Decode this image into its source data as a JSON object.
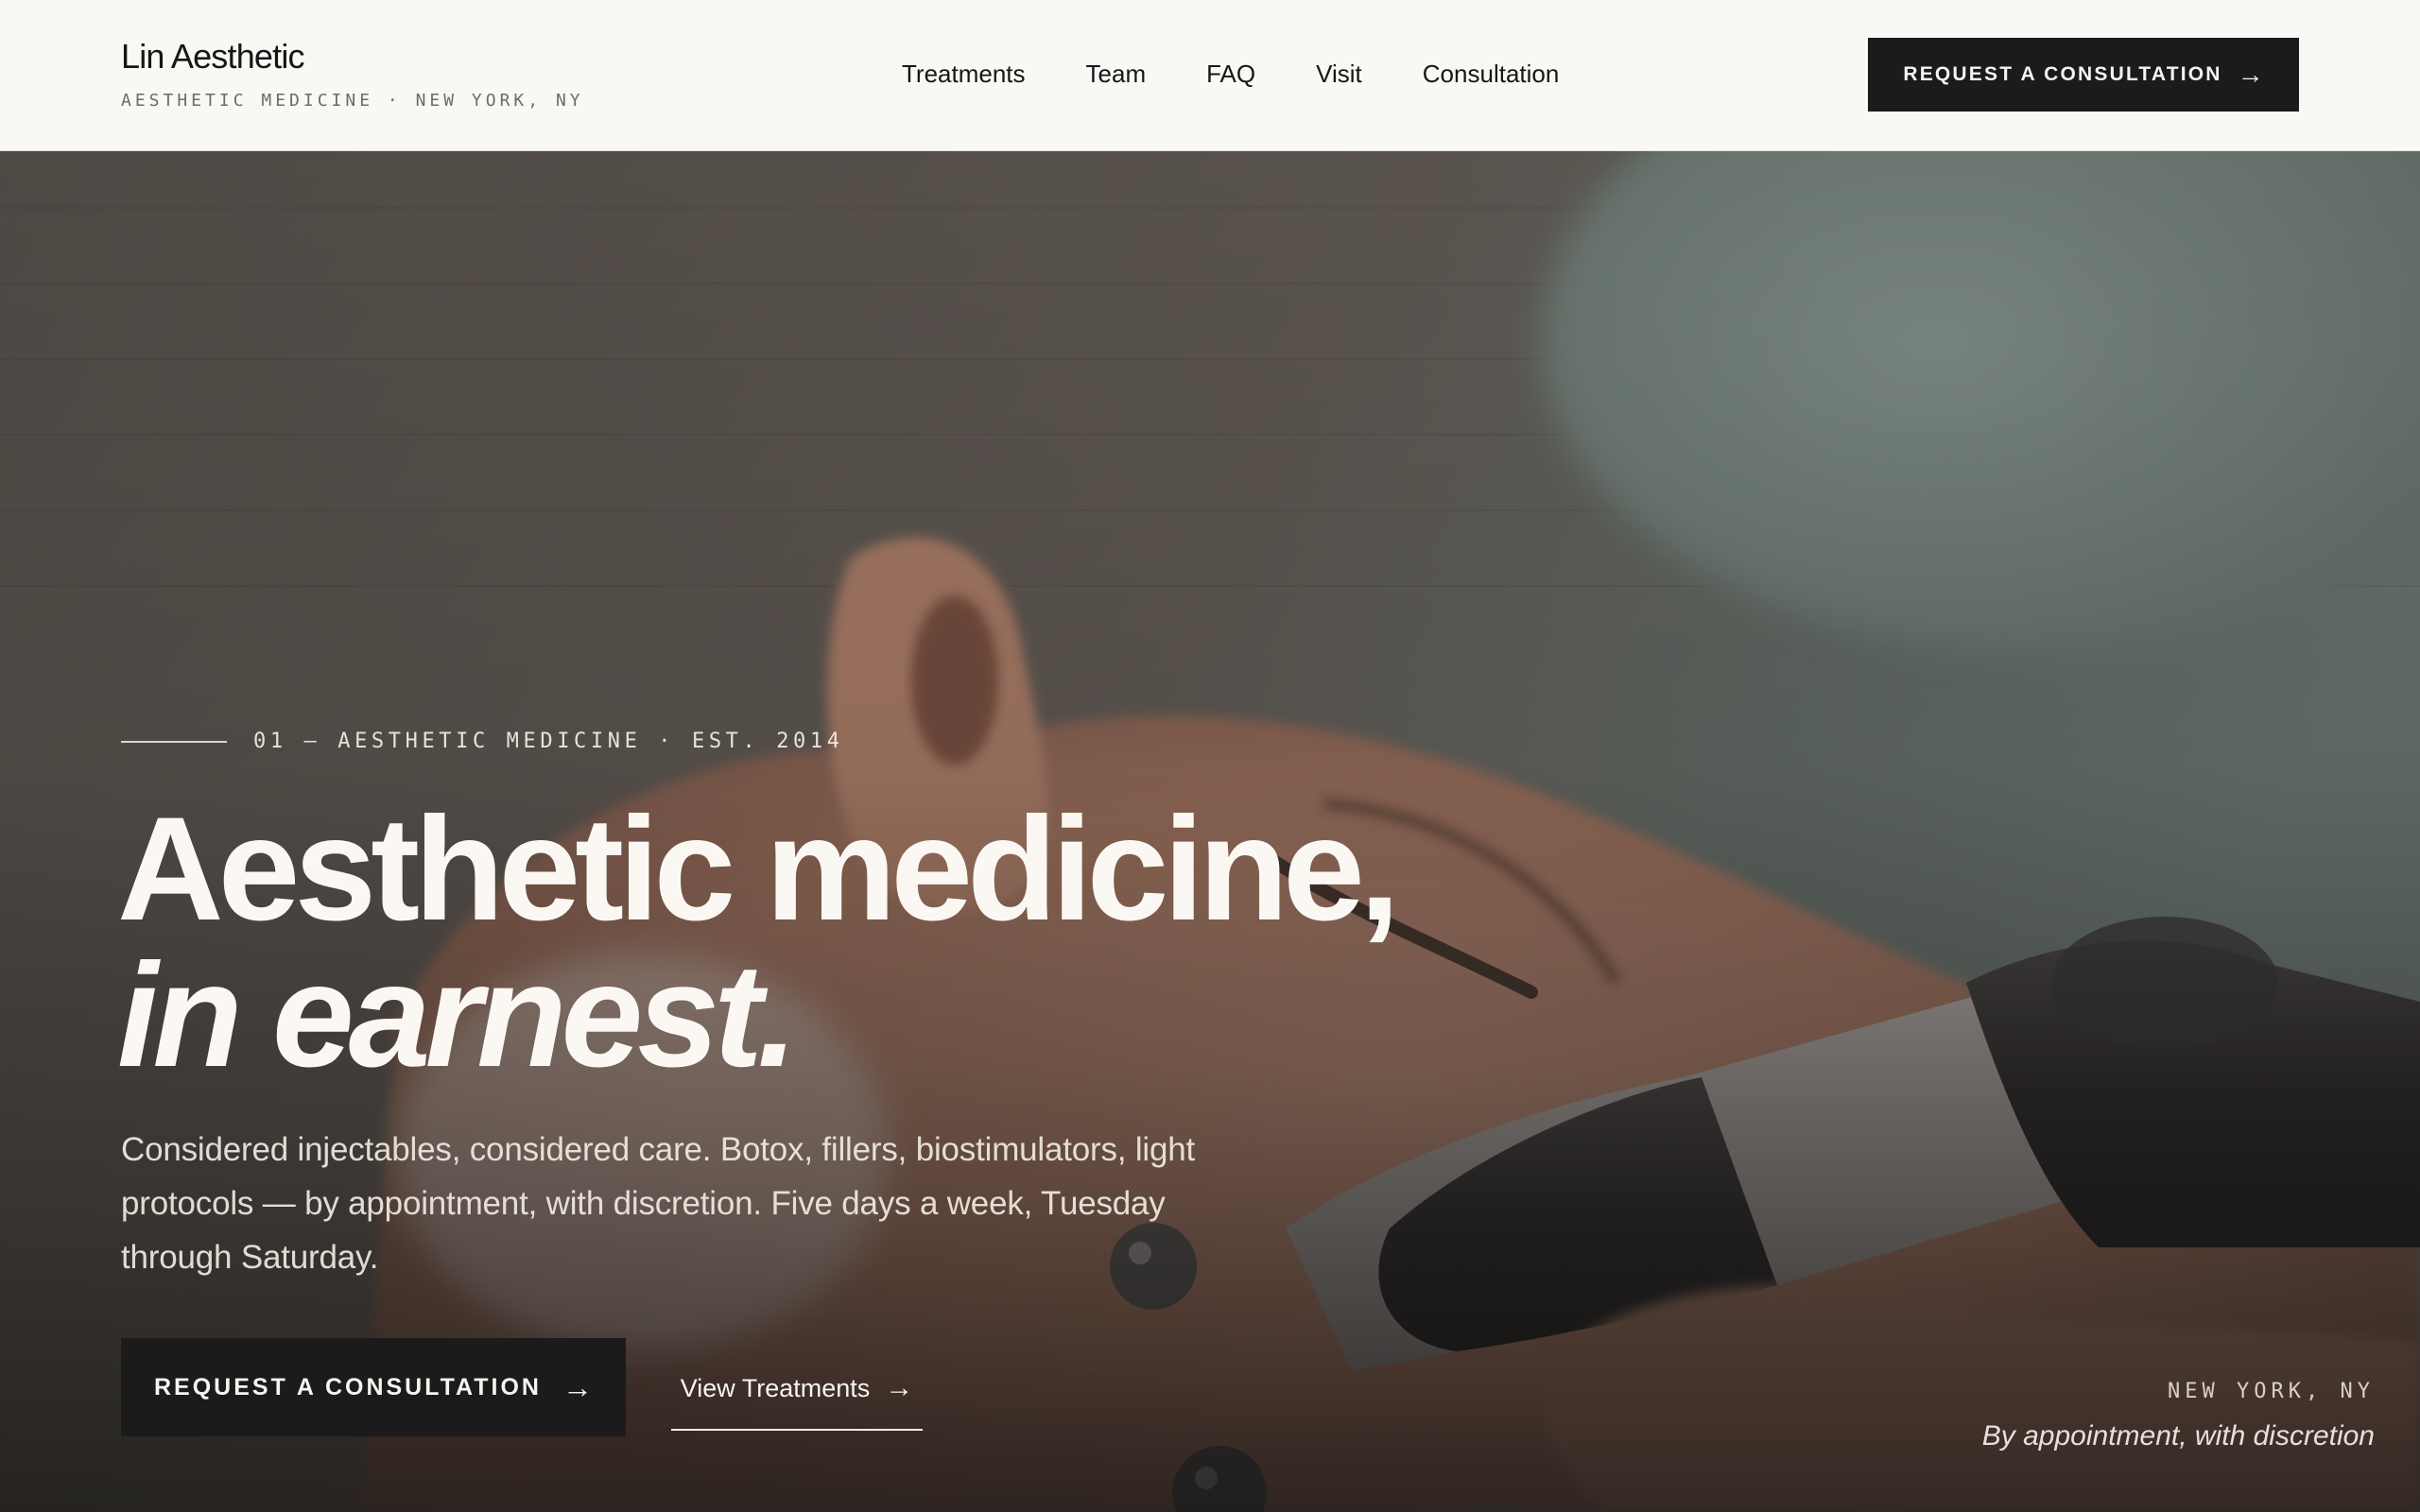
{
  "header": {
    "brand_name": "Lin Aesthetic",
    "brand_tagline": "AESTHETIC MEDICINE · NEW YORK, NY",
    "nav": [
      {
        "label": "Treatments"
      },
      {
        "label": "Team"
      },
      {
        "label": "FAQ"
      },
      {
        "label": "Visit"
      },
      {
        "label": "Consultation"
      }
    ],
    "cta_label": "REQUEST A CONSULTATION",
    "cta_icon": "arrow-right-icon"
  },
  "hero": {
    "eyebrow": "01 — AESTHETIC MEDICINE · EST. 2014",
    "headline_line1": "Aesthetic medicine,",
    "headline_line2": "in earnest.",
    "lede": "Considered injectables, considered care. Botox, fillers, biostimulators, light protocols — by appointment, with discretion. Five days a week, Tuesday through Saturday.",
    "primary_cta": "REQUEST A CONSULTATION",
    "secondary_cta": "View Treatments",
    "arrow": "→",
    "location": "NEW YORK, NY",
    "location_note": "By appointment, with discretion"
  },
  "colors": {
    "page_bg": "#f9f8f4",
    "button_bg": "#1b1b1b",
    "button_text": "#f6f4ef",
    "hero_text": "#fbf8f3"
  }
}
